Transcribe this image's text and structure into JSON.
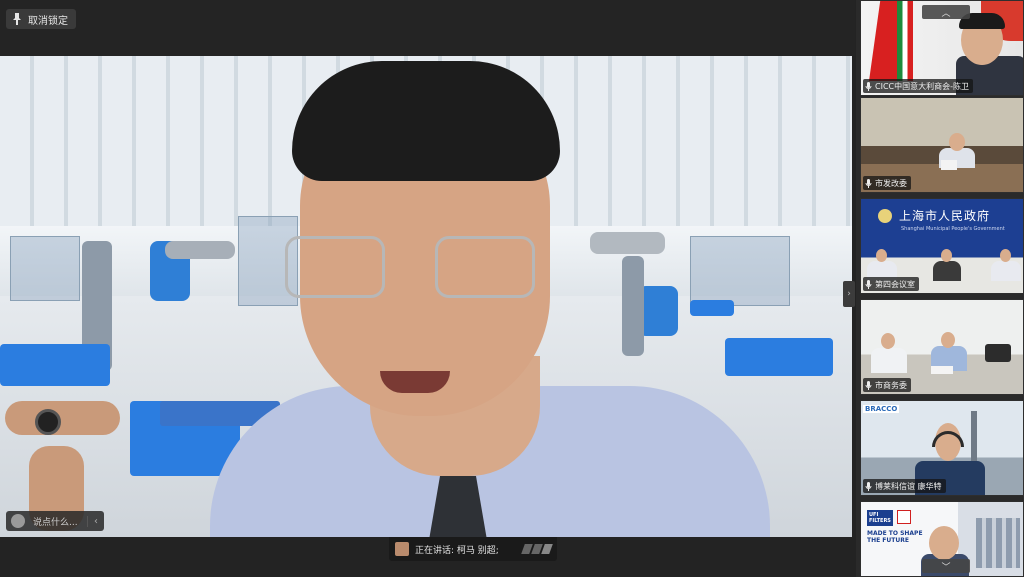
{
  "toolbar": {
    "unpin_label": "取消锁定",
    "unpin_icon": "pin-icon"
  },
  "main": {
    "comment_placeholder": "说点什么...",
    "speaking_label": "正在讲话: 柯马 别超;"
  },
  "participants": [
    {
      "name": "CICC中国意大利商会-陈卫",
      "mic_icon": "mic-icon"
    },
    {
      "name": "市发改委",
      "mic_icon": "mic-icon"
    },
    {
      "name": "第四会议室",
      "mic_icon": "mic-icon",
      "banner_cn": "上海市人民政府",
      "banner_en": "Shanghai Municipal People's Government"
    },
    {
      "name": "市商务委",
      "mic_icon": "mic-icon"
    },
    {
      "name": "博莱科信谊 康华特",
      "mic_icon": "mic-icon",
      "logo_text": "BRACCO"
    },
    {
      "name": "",
      "mic_icon": "mic-icon",
      "logo_text": "UFI FILTERS",
      "slogan": "MADE TO SHAPE THE FUTURE"
    }
  ],
  "colors": {
    "accent_blue": "#2f7fd6",
    "panel_bg": "#2a2a2a",
    "banner_blue": "#1d3f92"
  }
}
